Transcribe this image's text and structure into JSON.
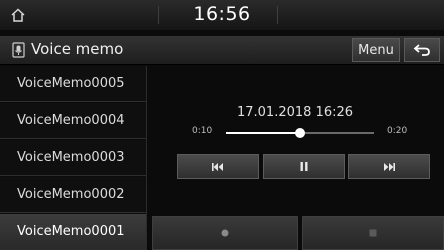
{
  "status_bar": {
    "time": "16:56",
    "home_icon": "home-icon"
  },
  "title_bar": {
    "title": "Voice memo",
    "title_icon": "voice-memo-icon",
    "menu_label": "Menu",
    "back_icon": "back-arrow-icon"
  },
  "file_list": {
    "items": [
      {
        "label": "VoiceMemo0005"
      },
      {
        "label": "VoiceMemo0004"
      },
      {
        "label": "VoiceMemo0003"
      },
      {
        "label": "VoiceMemo0002"
      },
      {
        "label": "VoiceMemo0001"
      }
    ],
    "selected_index": 4
  },
  "player": {
    "recording_datetime": "17.01.2018 16:26",
    "elapsed": "0:10",
    "total": "0:20",
    "progress_fraction": 0.5,
    "controls": [
      "previous-icon",
      "pause-icon",
      "next-icon"
    ]
  },
  "bottom_controls": [
    "record-icon",
    "stop-icon"
  ],
  "colors": {
    "background": "#0b0b0b",
    "selected_row": "#3c3c3c",
    "text": "#e6e6e6"
  }
}
